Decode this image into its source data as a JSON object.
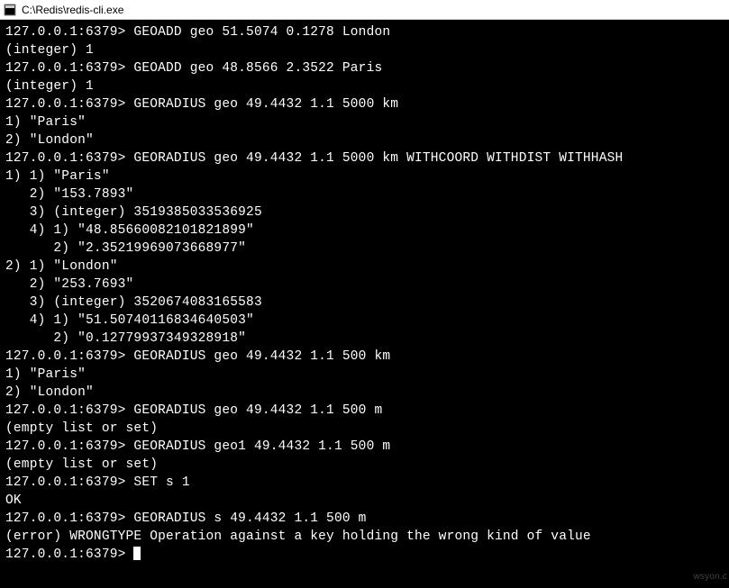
{
  "window": {
    "title": "C:\\Redis\\redis-cli.exe"
  },
  "prompt": "127.0.0.1:6379> ",
  "lines": [
    "127.0.0.1:6379> GEOADD geo 51.5074 0.1278 London",
    "(integer) 1",
    "127.0.0.1:6379> GEOADD geo 48.8566 2.3522 Paris",
    "(integer) 1",
    "127.0.0.1:6379> GEORADIUS geo 49.4432 1.1 5000 km",
    "1) \"Paris\"",
    "2) \"London\"",
    "127.0.0.1:6379> GEORADIUS geo 49.4432 1.1 5000 km WITHCOORD WITHDIST WITHHASH",
    "1) 1) \"Paris\"",
    "   2) \"153.7893\"",
    "   3) (integer) 3519385033536925",
    "   4) 1) \"48.85660082101821899\"",
    "      2) \"2.35219969073668977\"",
    "2) 1) \"London\"",
    "   2) \"253.7693\"",
    "   3) (integer) 3520674083165583",
    "   4) 1) \"51.50740116834640503\"",
    "      2) \"0.12779937349328918\"",
    "127.0.0.1:6379> GEORADIUS geo 49.4432 1.1 500 km",
    "1) \"Paris\"",
    "2) \"London\"",
    "127.0.0.1:6379> GEORADIUS geo 49.4432 1.1 500 m",
    "(empty list or set)",
    "127.0.0.1:6379> GEORADIUS geo1 49.4432 1.1 500 m",
    "(empty list or set)",
    "127.0.0.1:6379> SET s 1",
    "OK",
    "127.0.0.1:6379> GEORADIUS s 49.4432 1.1 500 m",
    "(error) WRONGTYPE Operation against a key holding the wrong kind of value"
  ],
  "watermark": "wsyon.c"
}
